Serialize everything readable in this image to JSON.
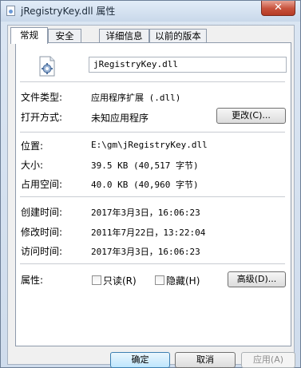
{
  "window": {
    "title": "jRegistryKey.dll 属性",
    "close_symbol": "✕"
  },
  "tabs": [
    {
      "label": "常规"
    },
    {
      "label": "安全"
    },
    {
      "label": "详细信息"
    },
    {
      "label": "以前的版本"
    }
  ],
  "general": {
    "file_name": "jRegistryKey.dll",
    "file_type_label": "文件类型:",
    "file_type_value": "应用程序扩展 (.dll)",
    "open_with_label": "打开方式:",
    "open_with_value": "未知应用程序",
    "change_button": "更改(C)...",
    "location_label": "位置:",
    "location_value": "E:\\gm\\jRegistryKey.dll",
    "size_label": "大小:",
    "size_value": "39.5 KB (40,517 字节)",
    "disk_size_label": "占用空间:",
    "disk_size_value": "40.0 KB (40,960 字节)",
    "created_label": "创建时间:",
    "created_value": "2017年3月3日，16:06:23",
    "modified_label": "修改时间:",
    "modified_value": "2011年7月22日，13:22:04",
    "accessed_label": "访问时间:",
    "accessed_value": "2017年3月3日，16:06:23",
    "attributes_label": "属性:",
    "readonly_label": "只读(R)",
    "readonly_checked": false,
    "hidden_label": "隐藏(H)",
    "hidden_checked": false,
    "advanced_button": "高级(D)..."
  },
  "footer": {
    "ok_button": "确定",
    "cancel_button": "取消",
    "apply_button": "应用(A)"
  }
}
